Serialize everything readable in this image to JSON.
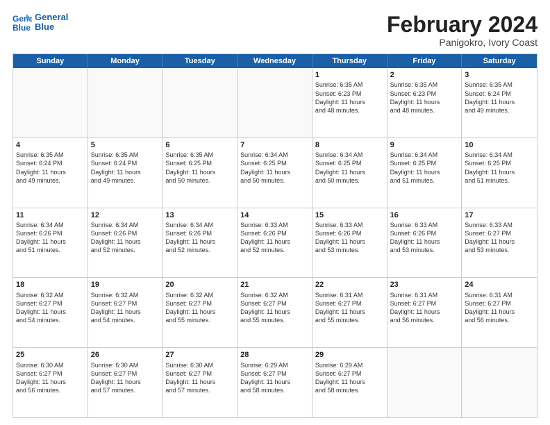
{
  "header": {
    "logo_line1": "General",
    "logo_line2": "Blue",
    "title": "February 2024",
    "subtitle": "Panigokro, Ivory Coast"
  },
  "days_of_week": [
    "Sunday",
    "Monday",
    "Tuesday",
    "Wednesday",
    "Thursday",
    "Friday",
    "Saturday"
  ],
  "weeks": [
    [
      {
        "day": "",
        "info": ""
      },
      {
        "day": "",
        "info": ""
      },
      {
        "day": "",
        "info": ""
      },
      {
        "day": "",
        "info": ""
      },
      {
        "day": "1",
        "info": "Sunrise: 6:35 AM\nSunset: 6:23 PM\nDaylight: 11 hours\nand 48 minutes."
      },
      {
        "day": "2",
        "info": "Sunrise: 6:35 AM\nSunset: 6:23 PM\nDaylight: 11 hours\nand 48 minutes."
      },
      {
        "day": "3",
        "info": "Sunrise: 6:35 AM\nSunset: 6:24 PM\nDaylight: 11 hours\nand 49 minutes."
      }
    ],
    [
      {
        "day": "4",
        "info": "Sunrise: 6:35 AM\nSunset: 6:24 PM\nDaylight: 11 hours\nand 49 minutes."
      },
      {
        "day": "5",
        "info": "Sunrise: 6:35 AM\nSunset: 6:24 PM\nDaylight: 11 hours\nand 49 minutes."
      },
      {
        "day": "6",
        "info": "Sunrise: 6:35 AM\nSunset: 6:25 PM\nDaylight: 11 hours\nand 50 minutes."
      },
      {
        "day": "7",
        "info": "Sunrise: 6:34 AM\nSunset: 6:25 PM\nDaylight: 11 hours\nand 50 minutes."
      },
      {
        "day": "8",
        "info": "Sunrise: 6:34 AM\nSunset: 6:25 PM\nDaylight: 11 hours\nand 50 minutes."
      },
      {
        "day": "9",
        "info": "Sunrise: 6:34 AM\nSunset: 6:25 PM\nDaylight: 11 hours\nand 51 minutes."
      },
      {
        "day": "10",
        "info": "Sunrise: 6:34 AM\nSunset: 6:25 PM\nDaylight: 11 hours\nand 51 minutes."
      }
    ],
    [
      {
        "day": "11",
        "info": "Sunrise: 6:34 AM\nSunset: 6:26 PM\nDaylight: 11 hours\nand 51 minutes."
      },
      {
        "day": "12",
        "info": "Sunrise: 6:34 AM\nSunset: 6:26 PM\nDaylight: 11 hours\nand 52 minutes."
      },
      {
        "day": "13",
        "info": "Sunrise: 6:34 AM\nSunset: 6:26 PM\nDaylight: 11 hours\nand 52 minutes."
      },
      {
        "day": "14",
        "info": "Sunrise: 6:33 AM\nSunset: 6:26 PM\nDaylight: 11 hours\nand 52 minutes."
      },
      {
        "day": "15",
        "info": "Sunrise: 6:33 AM\nSunset: 6:26 PM\nDaylight: 11 hours\nand 53 minutes."
      },
      {
        "day": "16",
        "info": "Sunrise: 6:33 AM\nSunset: 6:26 PM\nDaylight: 11 hours\nand 53 minutes."
      },
      {
        "day": "17",
        "info": "Sunrise: 6:33 AM\nSunset: 6:27 PM\nDaylight: 11 hours\nand 53 minutes."
      }
    ],
    [
      {
        "day": "18",
        "info": "Sunrise: 6:32 AM\nSunset: 6:27 PM\nDaylight: 11 hours\nand 54 minutes."
      },
      {
        "day": "19",
        "info": "Sunrise: 6:32 AM\nSunset: 6:27 PM\nDaylight: 11 hours\nand 54 minutes."
      },
      {
        "day": "20",
        "info": "Sunrise: 6:32 AM\nSunset: 6:27 PM\nDaylight: 11 hours\nand 55 minutes."
      },
      {
        "day": "21",
        "info": "Sunrise: 6:32 AM\nSunset: 6:27 PM\nDaylight: 11 hours\nand 55 minutes."
      },
      {
        "day": "22",
        "info": "Sunrise: 6:31 AM\nSunset: 6:27 PM\nDaylight: 11 hours\nand 55 minutes."
      },
      {
        "day": "23",
        "info": "Sunrise: 6:31 AM\nSunset: 6:27 PM\nDaylight: 11 hours\nand 56 minutes."
      },
      {
        "day": "24",
        "info": "Sunrise: 6:31 AM\nSunset: 6:27 PM\nDaylight: 11 hours\nand 56 minutes."
      }
    ],
    [
      {
        "day": "25",
        "info": "Sunrise: 6:30 AM\nSunset: 6:27 PM\nDaylight: 11 hours\nand 56 minutes."
      },
      {
        "day": "26",
        "info": "Sunrise: 6:30 AM\nSunset: 6:27 PM\nDaylight: 11 hours\nand 57 minutes."
      },
      {
        "day": "27",
        "info": "Sunrise: 6:30 AM\nSunset: 6:27 PM\nDaylight: 11 hours\nand 57 minutes."
      },
      {
        "day": "28",
        "info": "Sunrise: 6:29 AM\nSunset: 6:27 PM\nDaylight: 11 hours\nand 58 minutes."
      },
      {
        "day": "29",
        "info": "Sunrise: 6:29 AM\nSunset: 6:27 PM\nDaylight: 11 hours\nand 58 minutes."
      },
      {
        "day": "",
        "info": ""
      },
      {
        "day": "",
        "info": ""
      }
    ]
  ]
}
